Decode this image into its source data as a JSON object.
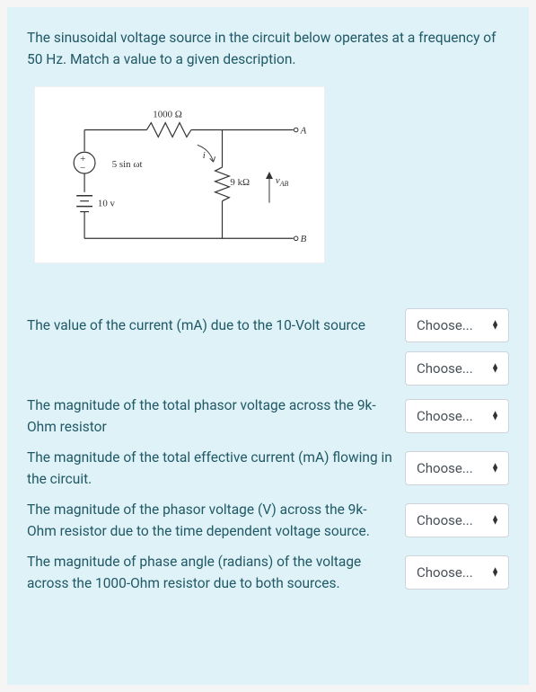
{
  "question": {
    "prompt": "The sinusoidal voltage source in the circuit below operates at a frequency of 50 Hz. Match a value to a given description."
  },
  "circuit": {
    "label_r1": "1000 Ω",
    "label_src_ac": "5 sin ωt",
    "label_src_dc": "10 v",
    "label_r2": "9 kΩ",
    "label_vab": "v",
    "label_vab_sub": "AB",
    "label_i": "i",
    "label_A": "A",
    "label_B": "B"
  },
  "rows": [
    {
      "label": "The value of the current (mA) due to the 10-Volt source",
      "placeholder": "Choose..."
    },
    {
      "label": "",
      "placeholder": "Choose..."
    },
    {
      "label": "The magnitude of the total phasor voltage across the 9k-Ohm resistor",
      "placeholder": "Choose..."
    },
    {
      "label": "The magnitude of the total effective current (mA) flowing in the circuit.",
      "placeholder": "Choose..."
    },
    {
      "label": "The magnitude of the phasor voltage (V) across the 9k-Ohm resistor due to the time dependent voltage source.",
      "placeholder": "Choose..."
    },
    {
      "label": "The magnitude of phase angle (radians) of the voltage across the 1000-Ohm resistor due to both sources.",
      "placeholder": "Choose..."
    }
  ]
}
